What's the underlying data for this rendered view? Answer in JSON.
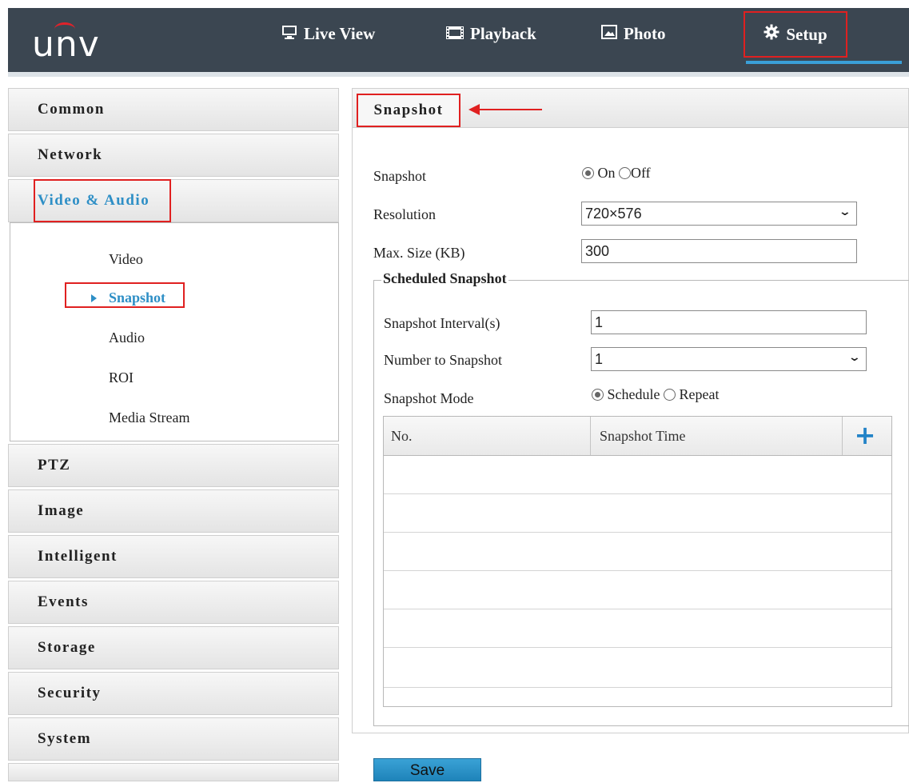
{
  "header": {
    "logo": "unv",
    "nav": [
      {
        "label": "Live View",
        "icon": "monitor-icon"
      },
      {
        "label": "Playback",
        "icon": "film-icon"
      },
      {
        "label": "Photo",
        "icon": "image-icon"
      },
      {
        "label": "Setup",
        "icon": "gear-icon"
      }
    ]
  },
  "sidebar": {
    "items": [
      "Common",
      "Network",
      "Video & Audio",
      "PTZ",
      "Image",
      "Intelligent",
      "Events",
      "Storage",
      "Security",
      "System"
    ],
    "submenu": [
      "Video",
      "Snapshot",
      "Audio",
      "ROI",
      "Media Stream"
    ],
    "active_sub": "Snapshot"
  },
  "main": {
    "tab": "Snapshot",
    "form": {
      "snapshot_label": "Snapshot",
      "on_label": "On",
      "off_label": "Off",
      "resolution_label": "Resolution",
      "resolution_value": "720×576",
      "maxsize_label": "Max. Size (KB)",
      "maxsize_value": "300"
    },
    "scheduled": {
      "legend": "Scheduled Snapshot",
      "interval_label": "Snapshot Interval(s)",
      "interval_value": "1",
      "number_label": "Number to Snapshot",
      "number_value": "1",
      "mode_label": "Snapshot Mode",
      "schedule_label": "Schedule",
      "repeat_label": "Repeat"
    },
    "table": {
      "col_no": "No.",
      "col_time": "Snapshot Time"
    },
    "save_label": "Save"
  },
  "colors": {
    "accent": "#2e8fc6",
    "highlight": "#e02020",
    "topbar": "#3b4651"
  }
}
